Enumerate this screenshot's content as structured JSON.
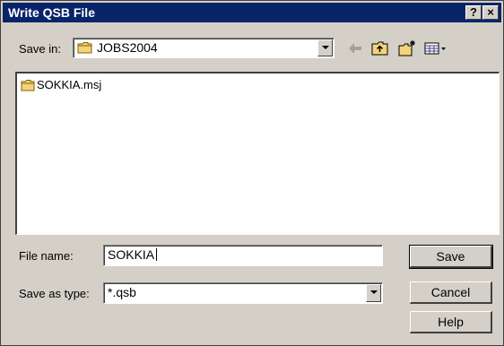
{
  "window": {
    "title": "Write QSB File",
    "help_caption": "?",
    "close_caption": "×"
  },
  "save_in": {
    "label": "Save in:",
    "value": "JOBS2004"
  },
  "files": [
    {
      "name": "SOKKIA.msj",
      "icon": "folder-icon"
    }
  ],
  "file_name": {
    "label": "File name:",
    "value": "SOKKIA"
  },
  "save_as_type": {
    "label": "Save as type:",
    "value": "*.qsb"
  },
  "buttons": {
    "save": "Save",
    "cancel": "Cancel",
    "help": "Help"
  },
  "toolbar": {
    "icons": [
      "back-arrow-icon",
      "up-one-level-icon",
      "create-new-folder-icon",
      "view-menu-icon"
    ]
  },
  "colors": {
    "titlebar": "#0a246a",
    "face": "#d4d0c8",
    "folder": "#f4d47a"
  }
}
